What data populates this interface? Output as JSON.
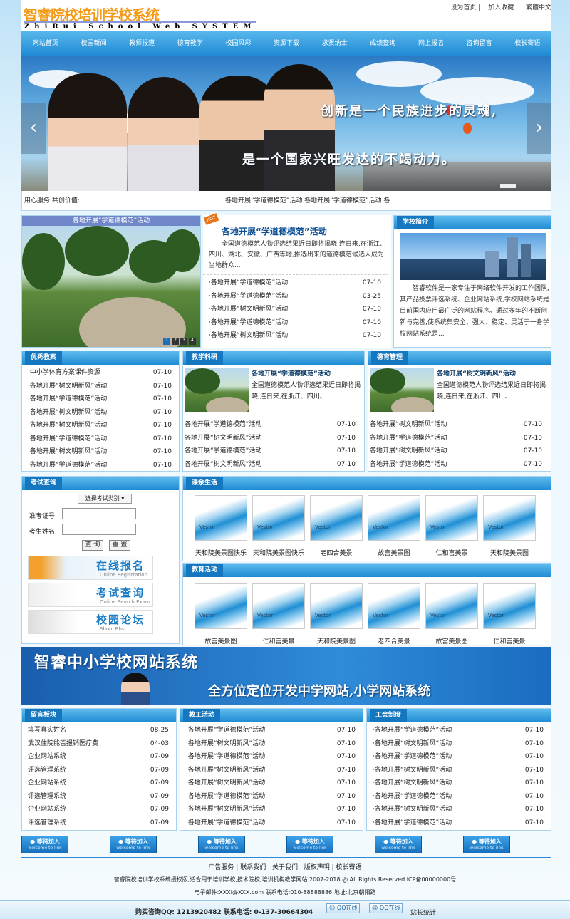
{
  "header": {
    "logo_cn": "智睿院校培训学校系统",
    "logo_en": "ZhiRui School Web SYSTEM",
    "links": [
      "设为首页",
      "加入收藏",
      "繁體中文"
    ]
  },
  "nav": [
    "网站首页",
    "校园新闻",
    "教师报道",
    "德育教学",
    "校园风彩",
    "资源下载",
    "求贤纳士",
    "成绩查询",
    "网上报名",
    "咨询留言",
    "校长寄语"
  ],
  "banner": {
    "slogan1": "创新是一个民族进步的灵魂,",
    "slogan2": "是一个国家兴旺发达的不竭动力。",
    "prev": "‹",
    "next": "›"
  },
  "ticker": {
    "label": "用心服务 共创价值:",
    "text": "各地开展“学道德模范”活动    各地开展“学道德模范”活动    各"
  },
  "slide": {
    "caption": "各地开展“学道德模范”活动",
    "dots": [
      "1",
      "2",
      "3",
      "4"
    ]
  },
  "headline": {
    "hot": "HOT",
    "title": "各地开展“学道德模范”活动",
    "summary": "全国道德模范人物评选结果近日即将揭晓,连日来,在浙江、四川、湖北、安徽、广西等地,推选出来的道德模范候选人成为当地群众...",
    "items": [
      {
        "t": "·各地开展“学道德模范”活动",
        "d": "07-10"
      },
      {
        "t": "·各地开展“学道德模范”活动",
        "d": "03-25"
      },
      {
        "t": "·各地开展“树文明新风”活动",
        "d": "07-10"
      },
      {
        "t": "·各地开展“学道德模范”活动",
        "d": "07-10"
      },
      {
        "t": "·各地开展“树文明新风”活动",
        "d": "07-10"
      }
    ]
  },
  "intro": {
    "title": "学校简介",
    "text": "智睿软件是一家专注于网络软件开发的工作团队,其产品投票评选系统、企业网站系统,学校网站系统是目前国内应用最广泛的网站程序。通过多年的不断创新与完善,使系统集安全、强大、稳定、灵活于一身学校网站系统是..."
  },
  "excellent": {
    "title": "优秀教案",
    "items": [
      {
        "t": "·中小学体育方案课件资源",
        "d": "07-10"
      },
      {
        "t": "·各地开展“树文明新风”活动",
        "d": "07-10"
      },
      {
        "t": "·各地开展“学道德模范”活动",
        "d": "07-10"
      },
      {
        "t": "·各地开展“树文明新风”活动",
        "d": "07-10"
      },
      {
        "t": "·各地开展“树文明新风”活动",
        "d": "07-10"
      },
      {
        "t": "·各地开展“学道德模范”活动",
        "d": "07-10"
      },
      {
        "t": "·各地开展“树文明新风”活动",
        "d": "07-10"
      },
      {
        "t": "·各地开展“学道德模范”活动",
        "d": "07-10"
      }
    ]
  },
  "research": {
    "title": "教学科研",
    "feat_title": "各地开展“学道德模范”活动",
    "feat_text": "全国道德模范人物评选结果近日即将揭晓,连日来,在浙江、四川、",
    "items": [
      {
        "t": "各地开展“学道德模范”活动",
        "d": "07-10"
      },
      {
        "t": "各地开展“树文明新风”活动",
        "d": "07-10"
      },
      {
        "t": "各地开展“学道德模范”活动",
        "d": "07-10"
      },
      {
        "t": "各地开展“树文明新风”活动",
        "d": "07-10"
      }
    ]
  },
  "moral": {
    "title": "德育管理",
    "feat_title": "各地开展“树文明新风”活动",
    "feat_text": "全国道德模范人物评选结果近日即将揭晓,连日来,在浙江、四川、",
    "items": [
      {
        "t": "各地开展“树文明新风”活动",
        "d": "07-10"
      },
      {
        "t": "各地开展“学道德模范”活动",
        "d": "07-10"
      },
      {
        "t": "各地开展“树文明新风”活动",
        "d": "07-10"
      },
      {
        "t": "各地开展“学道德模范”活动",
        "d": "07-10"
      }
    ]
  },
  "exam": {
    "title": "考试查询",
    "select": "选择考试类别",
    "id_label": "准考证号:",
    "name_label": "考生姓名:",
    "query": "查 询",
    "reset": "重 置",
    "btns": [
      {
        "t": "在线报名",
        "s": "Online Registration"
      },
      {
        "t": "考试查询",
        "s": "Online Search Exam"
      },
      {
        "t": "校园论坛",
        "s": "Shool      Bbs"
      }
    ]
  },
  "after_class": {
    "title": "课余生活",
    "items": [
      "天和院美景图快乐",
      "天和院美景图快乐",
      "老四合美景",
      "故宫美景图",
      "仁和宫美景",
      "天和院美景图"
    ]
  },
  "activity": {
    "title": "教育活动",
    "items": [
      "故宫美景图",
      "仁和宫美景",
      "天和院美景图",
      "老四合美景",
      "故宫美景图",
      "仁和宫美景"
    ]
  },
  "pic_mark": "Vestor",
  "banner2": {
    "title": "智睿中小学校网站系统",
    "sub": "全方位定位开发中学网站,小学网站系统"
  },
  "guestbook": {
    "title": "留言板块",
    "items": [
      {
        "t": "填写真实姓名",
        "d": "08-25"
      },
      {
        "t": "武汉住院能否报销医疗费",
        "d": "04-03"
      },
      {
        "t": "企业网站系统",
        "d": "07-09"
      },
      {
        "t": "评选管理系统",
        "d": "07-09"
      },
      {
        "t": "企业网站系统",
        "d": "07-09"
      },
      {
        "t": "评选管理系统",
        "d": "07-09"
      },
      {
        "t": "企业网站系统",
        "d": "07-09"
      },
      {
        "t": "评选管理系统",
        "d": "07-09"
      }
    ]
  },
  "staff": {
    "title": "教工活动",
    "items": [
      {
        "t": "·各地开展“学道德模范”活动",
        "d": "07-10"
      },
      {
        "t": "·各地开展“树文明新风”活动",
        "d": "07-10"
      },
      {
        "t": "·各地开展“学道德模范”活动",
        "d": "07-10"
      },
      {
        "t": "·各地开展“树文明新风”活动",
        "d": "07-10"
      },
      {
        "t": "·各地开展“树文明新风”活动",
        "d": "07-10"
      },
      {
        "t": "·各地开展“学道德模范”活动",
        "d": "07-10"
      },
      {
        "t": "·各地开展“树文明新风”活动",
        "d": "07-10"
      },
      {
        "t": "·各地开展“学道德模范”活动",
        "d": "07-10"
      }
    ]
  },
  "union": {
    "title": "工会制度",
    "items": [
      {
        "t": "·各地开展“学道德模范”活动",
        "d": "07-10"
      },
      {
        "t": "·各地开展“树文明新风”活动",
        "d": "07-10"
      },
      {
        "t": "·各地开展“学道德模范”活动",
        "d": "07-10"
      },
      {
        "t": "·各地开展“树文明新风”活动",
        "d": "07-10"
      },
      {
        "t": "·各地开展“树文明新风”活动",
        "d": "07-10"
      },
      {
        "t": "·各地开展“学道德模范”活动",
        "d": "07-10"
      },
      {
        "t": "·各地开展“树文明新风”活动",
        "d": "07-10"
      },
      {
        "t": "·各地开展“学道德模范”活动",
        "d": "07-10"
      }
    ]
  },
  "friend": {
    "label": "● 等待加入",
    "sub": "welcome to link"
  },
  "footer": {
    "links": [
      "广告服务",
      "联系我们",
      "关于我们",
      "版权声明",
      "校长寄语"
    ],
    "line1": "智睿院校培训学校系统授权版,适合用于培训学校,技术院校,培训机构教学网站 2007-2018 @ All Rights Reserved ICP备00000000号",
    "line2": "电子邮件:XXXi@XXX.com 联系电话:010-88888886    地址:北京朝阳路",
    "buy": "购买咨询QQ: 1213920482   联系电话: 0-137-30664304",
    "qq": [
      "QQ在线",
      "QQ在线"
    ],
    "stat": "站长统计"
  }
}
